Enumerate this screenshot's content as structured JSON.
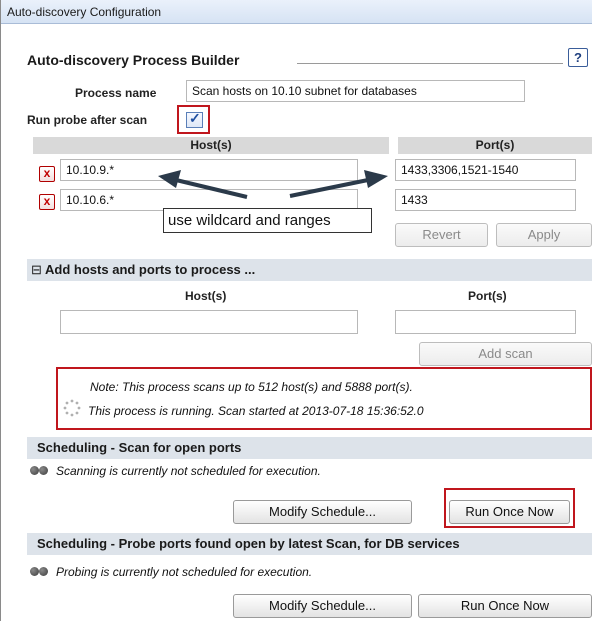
{
  "window": {
    "title": "Auto-discovery Configuration"
  },
  "builder": {
    "heading": "Auto-discovery Process Builder",
    "help_label": "?",
    "process_name_label": "Process name",
    "process_name_value": "Scan hosts on 10.10 subnet for databases",
    "run_probe_label": "Run probe after scan",
    "run_probe_checked": "✓",
    "hosts_header": "Host(s)",
    "ports_header": "Port(s)",
    "rows": [
      {
        "remove": "x",
        "host": "10.10.9.*",
        "port": "1433,3306,1521-1540"
      },
      {
        "remove": "x",
        "host": "10.10.6.*",
        "port": "1433"
      }
    ],
    "revert_label": "Revert",
    "apply_label": "Apply"
  },
  "annotation": {
    "callout_text": "use wildcard and ranges"
  },
  "add_section": {
    "toggle": "⊟",
    "title": "Add hosts and ports to process ...",
    "hosts_header": "Host(s)",
    "ports_header": "Port(s)",
    "host_value": "",
    "port_value": "",
    "add_scan_label": "Add scan"
  },
  "notice": {
    "line1": "Note: This process scans up to 512 host(s) and 5888 port(s).",
    "line2": "This process is running. Scan started at 2013-07-18 15:36:52.0"
  },
  "scan_schedule": {
    "title": "Scheduling - Scan for open ports",
    "status": "Scanning is currently not scheduled for execution.",
    "modify_label": "Modify Schedule...",
    "run_label": "Run Once Now"
  },
  "probe_schedule": {
    "title": "Scheduling - Probe ports found open by latest Scan, for DB services",
    "status": "Probing is currently not scheduled for execution.",
    "modify_label": "Modify Schedule...",
    "run_label": "Run Once Now"
  },
  "colors": {
    "highlight": "#c0161d",
    "band": "#dde3ea",
    "arrow": "#2b3a4a"
  }
}
